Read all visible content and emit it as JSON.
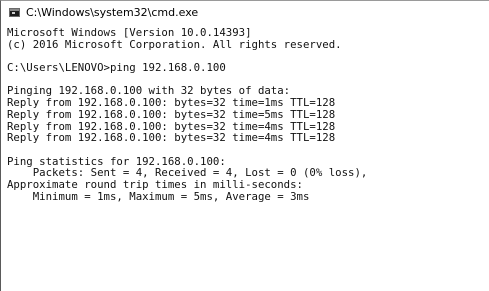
{
  "window": {
    "title": "C:\\Windows\\system32\\cmd.exe",
    "icon": "console-icon"
  },
  "console": {
    "lines": [
      "Microsoft Windows [Version 10.0.14393]",
      "(c) 2016 Microsoft Corporation. All rights reserved.",
      "",
      "C:\\Users\\LENOVO>ping 192.168.0.100",
      "",
      "Pinging 192.168.0.100 with 32 bytes of data:",
      "Reply from 192.168.0.100: bytes=32 time=1ms TTL=128",
      "Reply from 192.168.0.100: bytes=32 time=5ms TTL=128",
      "Reply from 192.168.0.100: bytes=32 time=4ms TTL=128",
      "Reply from 192.168.0.100: bytes=32 time=4ms TTL=128",
      "",
      "Ping statistics for 192.168.0.100:",
      "    Packets: Sent = 4, Received = 4, Lost = 0 (0% loss),",
      "Approximate round trip times in milli-seconds:",
      "    Minimum = 1ms, Maximum = 5ms, Average = 3ms"
    ]
  }
}
